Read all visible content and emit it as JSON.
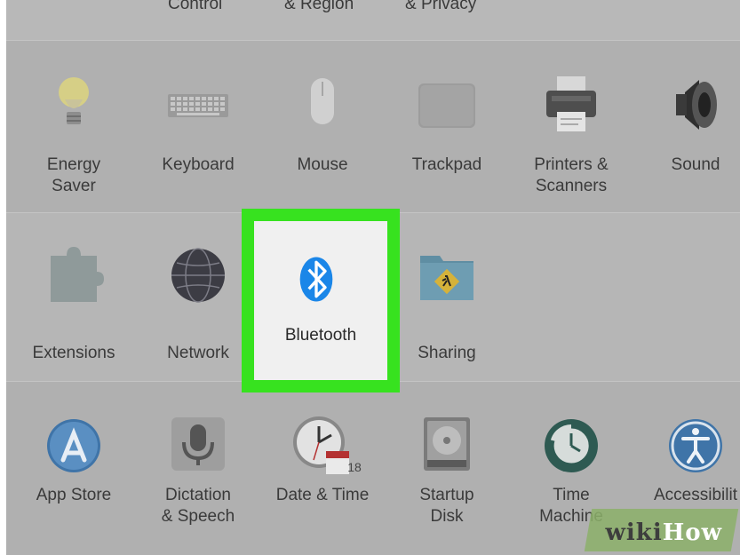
{
  "top_row": {
    "labels": [
      "Control",
      "& Region",
      "& Privacy"
    ]
  },
  "hardware_row": [
    {
      "label": "Energy\nSaver",
      "icon": "lightbulb-icon"
    },
    {
      "label": "Keyboard",
      "icon": "keyboard-icon"
    },
    {
      "label": "Mouse",
      "icon": "mouse-icon"
    },
    {
      "label": "Trackpad",
      "icon": "trackpad-icon"
    },
    {
      "label": "Printers &\nScanners",
      "icon": "printer-icon"
    },
    {
      "label": "Sound",
      "icon": "speaker-icon"
    }
  ],
  "internet_row": [
    {
      "label": "Extensions",
      "icon": "puzzle-piece-icon"
    },
    {
      "label": "Network",
      "icon": "globe-icon"
    },
    {
      "label": "Bluetooth",
      "icon": "bluetooth-icon"
    },
    {
      "label": "Sharing",
      "icon": "sharing-folder-icon"
    }
  ],
  "system_row": [
    {
      "label": "App Store",
      "icon": "app-store-icon"
    },
    {
      "label": "Dictation\n& Speech",
      "icon": "microphone-icon"
    },
    {
      "label": "Date & Time",
      "icon": "clock-calendar-icon",
      "calendar_day": "18"
    },
    {
      "label": "Startup\nDisk",
      "icon": "hard-disk-icon"
    },
    {
      "label": "Time\nMachine",
      "icon": "time-machine-icon"
    },
    {
      "label": "Accessibilit",
      "icon": "accessibility-icon"
    }
  ],
  "highlight": {
    "color": "#37e21f"
  },
  "watermark": {
    "part1": "wiki",
    "part2": "How"
  }
}
